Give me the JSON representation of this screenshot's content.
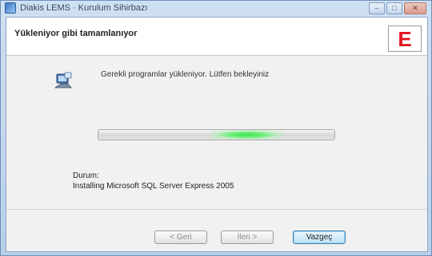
{
  "window": {
    "title": "Diakis LEMS · Kurulum Sihirbazı",
    "controls": {
      "minimize": "–",
      "maximize": "□",
      "close": "✕"
    }
  },
  "header": {
    "title": "Yükleniyor gibi tamamlanıyor",
    "logo_letter": "E"
  },
  "main": {
    "status_text": "Gerekli programlar yükleniyor. Lütfen bekleyiniz",
    "progress_indeterminate": true,
    "step_label": "Durum:",
    "step_value": "Installing Microsoft SQL Server Express 2005"
  },
  "footer": {
    "back_label": "< Geri",
    "next_label": "İleri >",
    "cancel_label": "Vazgeç"
  },
  "colors": {
    "logo_red": "#e1161f",
    "progress_green": "#3ee24c",
    "title_bar": "#cfe0f3"
  },
  "icons": {
    "app": "installer-window-icon",
    "setup": "setup-computer-icon"
  }
}
